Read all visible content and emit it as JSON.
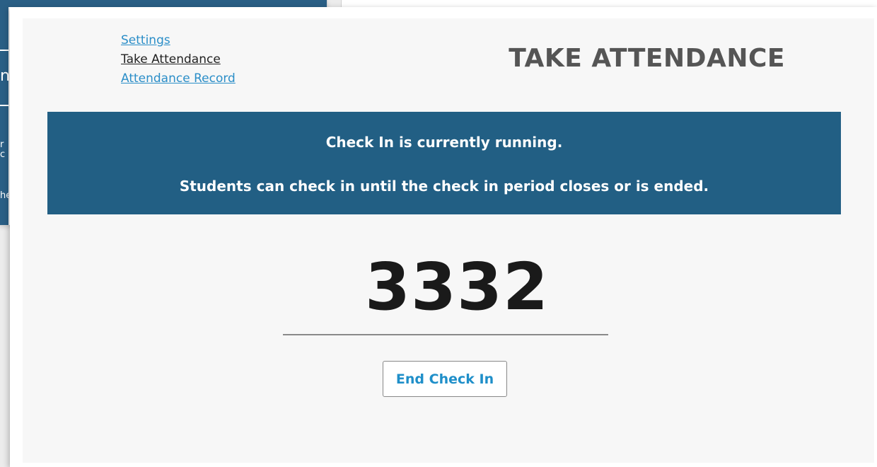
{
  "nav": {
    "items": [
      {
        "label": "Settings",
        "current": false
      },
      {
        "label": "Take Attendance",
        "current": true
      },
      {
        "label": "Attendance Record",
        "current": false
      }
    ]
  },
  "header": {
    "title": "TAKE ATTENDANCE"
  },
  "banner": {
    "line1": "Check In is currently running.",
    "line2": "Students can check in until the check in period closes or is ended."
  },
  "checkin": {
    "code": "3332",
    "end_button_label": "End Check In"
  },
  "background_window": {
    "fragments": [
      "n",
      "r c",
      "he"
    ]
  },
  "colors": {
    "banner": "#225f84",
    "link": "#2b8ec8",
    "button_text": "#1f8fc9"
  }
}
